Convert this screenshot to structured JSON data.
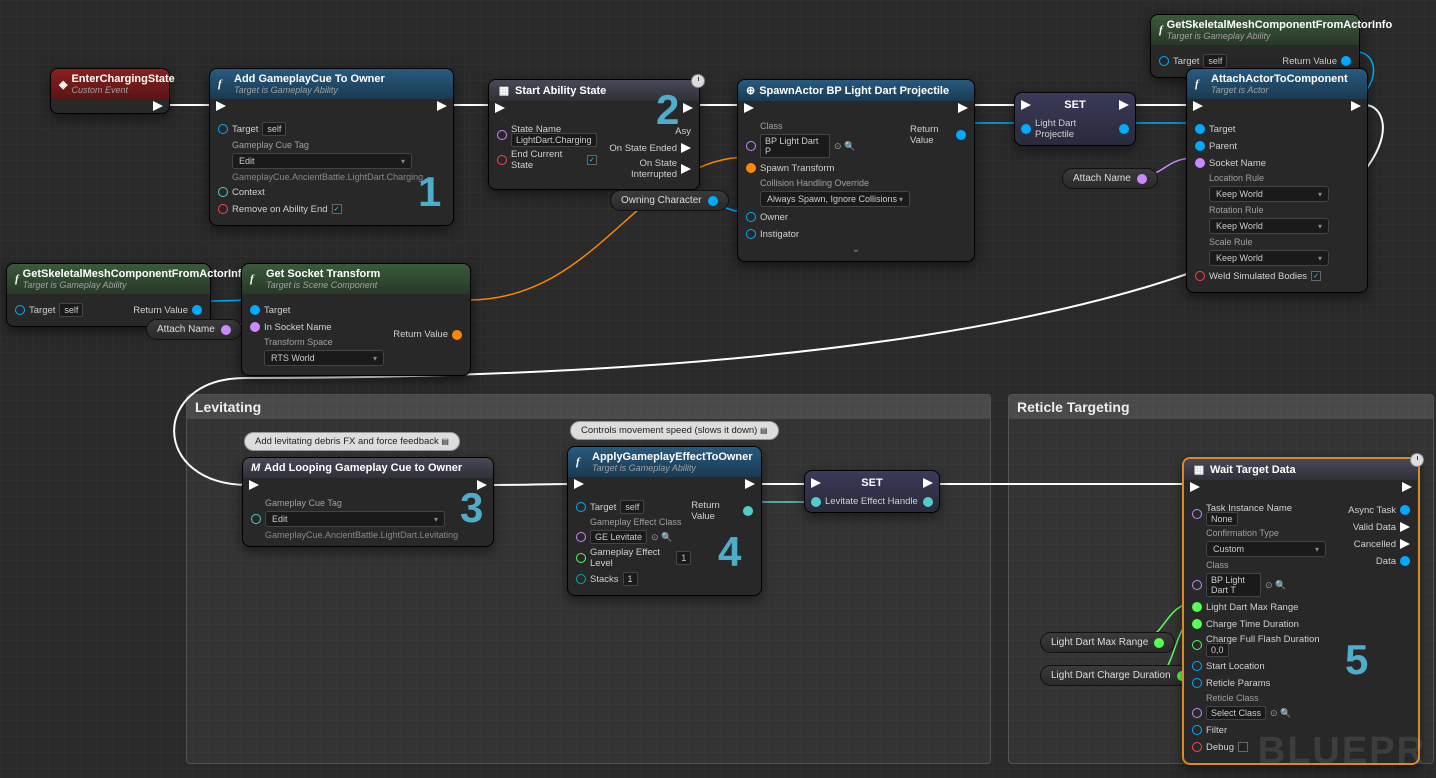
{
  "comments": {
    "levitating": {
      "title": "Levitating"
    },
    "reticle": {
      "title": "Reticle Targeting"
    }
  },
  "notes": {
    "debris": "Add levitating debris FX and force feedback",
    "movespeed": "Controls movement speed (slows it down)"
  },
  "overlays": {
    "n1": "1",
    "n2": "2",
    "n3": "3",
    "n4": "4",
    "n5": "5"
  },
  "watermark": "BLUEPR",
  "nodes": {
    "enterCharging": {
      "title": "EnterChargingState",
      "sub": "Custom Event"
    },
    "addCue": {
      "title": "Add GameplayCue To Owner",
      "sub": "Target is Gameplay Ability",
      "target": "Target",
      "self": "self",
      "tagLbl": "Gameplay Cue Tag",
      "tagDrop": "Edit",
      "tagVal": "GameplayCue.AncientBattle.LightDart.Charging",
      "context": "Context",
      "remove": "Remove on Ability End"
    },
    "startState": {
      "title": "Start Ability State",
      "stateName": "State Name",
      "stateVal": "LightDart.Charging",
      "endCur": "End Current State",
      "async": "Asy",
      "onEnded": "On State Ended",
      "onInt": "On State Interrupted"
    },
    "spawn": {
      "title": "SpawnActor BP Light Dart Projectile",
      "class": "Class",
      "classVal": "BP Light Dart P",
      "spawnT": "Spawn Transform",
      "collision": "Collision Handling Override",
      "collisionVal": "Always Spawn, Ignore Collisions",
      "owner": "Owner",
      "instigator": "Instigator",
      "retval": "Return Value"
    },
    "set1": {
      "title": "SET",
      "var": "Light Dart Projectile"
    },
    "getMesh1": {
      "title": "GetSkeletalMeshComponentFromActorInfo",
      "sub": "Target is Gameplay Ability",
      "target": "Target",
      "self": "self",
      "retval": "Return Value"
    },
    "attach": {
      "title": "AttachActorToComponent",
      "sub": "Target is Actor",
      "target": "Target",
      "parent": "Parent",
      "socket": "Socket Name",
      "locRule": "Location Rule",
      "locVal": "Keep World",
      "rotRule": "Rotation Rule",
      "rotVal": "Keep World",
      "scaleRule": "Scale Rule",
      "scaleVal": "Keep World",
      "weld": "Weld Simulated Bodies"
    },
    "getMesh2": {
      "title": "GetSkeletalMeshComponentFromActorInfo",
      "sub": "Target is Gameplay Ability",
      "target": "Target",
      "self": "self",
      "retval": "Return Value"
    },
    "getSocket": {
      "title": "Get Socket Transform",
      "sub": "Target is Scene Component",
      "target": "Target",
      "inSocket": "In Socket Name",
      "tSpace": "Transform Space",
      "tSpaceVal": "RTS World",
      "retval": "Return Value"
    },
    "attachName": {
      "label": "Attach Name"
    },
    "owningChar": {
      "label": "Owning Character"
    },
    "addLoop": {
      "title": "Add Looping Gameplay Cue to Owner",
      "tagLbl": "Gameplay Cue Tag",
      "tagDrop": "Edit",
      "tagVal": "GameplayCue.AncientBattle.LightDart.Levitating"
    },
    "applyGE": {
      "title": "ApplyGameplayEffectToOwner",
      "sub": "Target is Gameplay Ability",
      "target": "Target",
      "self": "self",
      "geClass": "Gameplay Effect Class",
      "geVal": "GE Levitate",
      "geLevel": "Gameplay Effect Level",
      "levelVal": "1",
      "stacks": "Stacks",
      "stacksVal": "1",
      "retval": "Return Value"
    },
    "set2": {
      "title": "SET",
      "var": "Levitate Effect Handle"
    },
    "maxRange": {
      "label": "Light Dart Max Range"
    },
    "chargeDur": {
      "label": "Light Dart Charge Duration"
    },
    "waitTarget": {
      "title": "Wait Target Data",
      "taskName": "Task Instance Name",
      "taskVal": "None",
      "confType": "Confirmation Type",
      "confVal": "Custom",
      "class": "Class",
      "classVal": "BP Light Dart T",
      "maxRange": "Light Dart Max Range",
      "chargeTime": "Charge Time Duration",
      "flashDur": "Charge Full Flash Duration",
      "flashVal": "0,0",
      "startLoc": "Start Location",
      "retParams": "Reticle Params",
      "retClass": "Reticle Class",
      "retClassVal": "Select Class",
      "filter": "Filter",
      "debug": "Debug",
      "async": "Async Task",
      "validData": "Valid Data",
      "cancelled": "Cancelled",
      "data": "Data"
    }
  }
}
